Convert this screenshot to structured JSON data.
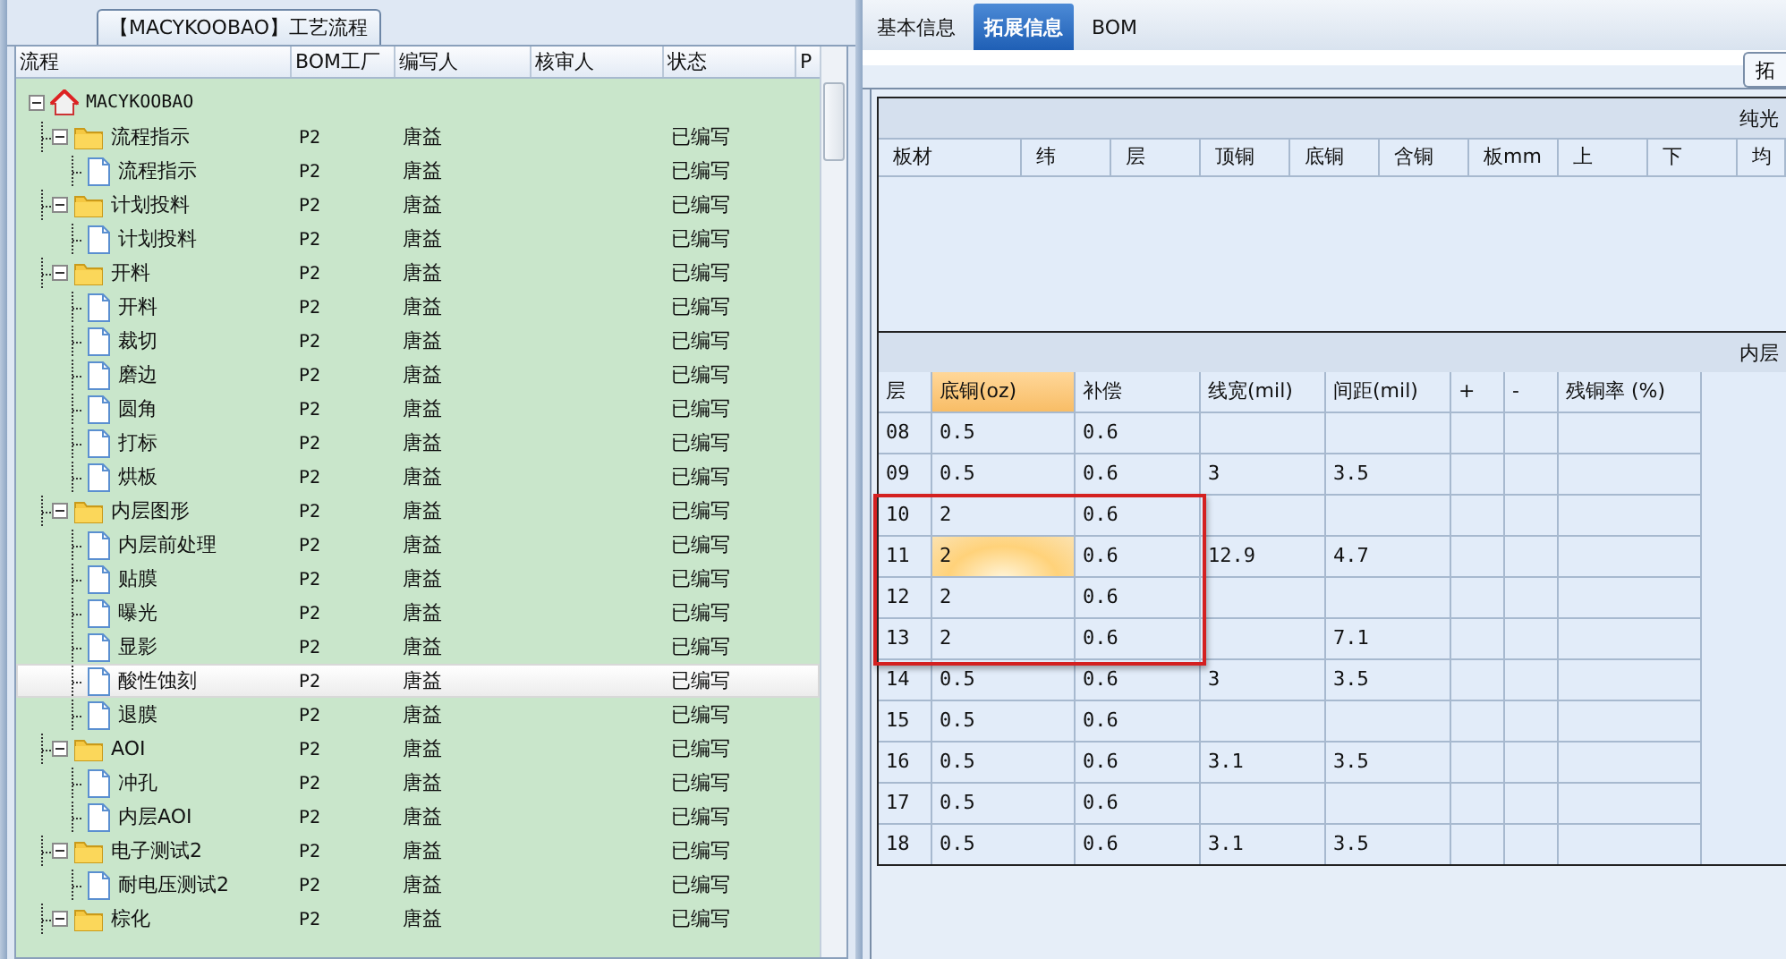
{
  "left_panel": {
    "title": "【MACYKOOBAO】工艺流程",
    "columns": [
      "流程",
      "BOM工厂",
      "编写人",
      "核审人",
      "状态",
      "P"
    ],
    "tree": {
      "label": "MACYKOOBAO",
      "kind": "root",
      "expanded": true,
      "selected": false,
      "children": [
        {
          "label": "流程指示",
          "kind": "folder",
          "expanded": true,
          "selected": false,
          "bom": "P2",
          "author": "唐益",
          "status": "已编写",
          "children": [
            {
              "label": "流程指示",
              "kind": "doc",
              "selected": false,
              "bom": "P2",
              "author": "唐益",
              "status": "已编写"
            }
          ]
        },
        {
          "label": "计划投料",
          "kind": "folder",
          "expanded": true,
          "selected": false,
          "bom": "P2",
          "author": "唐益",
          "status": "已编写",
          "children": [
            {
              "label": "计划投料",
              "kind": "doc",
              "selected": false,
              "bom": "P2",
              "author": "唐益",
              "status": "已编写"
            }
          ]
        },
        {
          "label": "开料",
          "kind": "folder",
          "expanded": true,
          "selected": false,
          "bom": "P2",
          "author": "唐益",
          "status": "已编写",
          "children": [
            {
              "label": "开料",
              "kind": "doc",
              "selected": false,
              "bom": "P2",
              "author": "唐益",
              "status": "已编写"
            },
            {
              "label": "裁切",
              "kind": "doc",
              "selected": false,
              "bom": "P2",
              "author": "唐益",
              "status": "已编写"
            },
            {
              "label": "磨边",
              "kind": "doc",
              "selected": false,
              "bom": "P2",
              "author": "唐益",
              "status": "已编写"
            },
            {
              "label": "圆角",
              "kind": "doc",
              "selected": false,
              "bom": "P2",
              "author": "唐益",
              "status": "已编写"
            },
            {
              "label": "打标",
              "kind": "doc",
              "selected": false,
              "bom": "P2",
              "author": "唐益",
              "status": "已编写"
            },
            {
              "label": "烘板",
              "kind": "doc",
              "selected": false,
              "bom": "P2",
              "author": "唐益",
              "status": "已编写"
            }
          ]
        },
        {
          "label": "内层图形",
          "kind": "folder",
          "expanded": true,
          "selected": false,
          "bom": "P2",
          "author": "唐益",
          "status": "已编写",
          "children": [
            {
              "label": "内层前处理",
              "kind": "doc",
              "selected": false,
              "bom": "P2",
              "author": "唐益",
              "status": "已编写"
            },
            {
              "label": "贴膜",
              "kind": "doc",
              "selected": false,
              "bom": "P2",
              "author": "唐益",
              "status": "已编写"
            },
            {
              "label": "曝光",
              "kind": "doc",
              "selected": false,
              "bom": "P2",
              "author": "唐益",
              "status": "已编写"
            },
            {
              "label": "显影",
              "kind": "doc",
              "selected": false,
              "bom": "P2",
              "author": "唐益",
              "status": "已编写"
            },
            {
              "label": "酸性蚀刻",
              "kind": "doc",
              "selected": true,
              "bom": "P2",
              "author": "唐益",
              "status": "已编写"
            },
            {
              "label": "退膜",
              "kind": "doc",
              "selected": false,
              "bom": "P2",
              "author": "唐益",
              "status": "已编写"
            }
          ]
        },
        {
          "label": "AOI",
          "kind": "folder",
          "expanded": true,
          "selected": false,
          "bom": "P2",
          "author": "唐益",
          "status": "已编写",
          "children": [
            {
              "label": "冲孔",
              "kind": "doc",
              "selected": false,
              "bom": "P2",
              "author": "唐益",
              "status": "已编写"
            },
            {
              "label": "内层AOI",
              "kind": "doc",
              "selected": false,
              "bom": "P2",
              "author": "唐益",
              "status": "已编写"
            }
          ]
        },
        {
          "label": "电子测试2",
          "kind": "folder",
          "expanded": true,
          "selected": false,
          "bom": "P2",
          "author": "唐益",
          "status": "已编写",
          "children": [
            {
              "label": "耐电压测试2",
              "kind": "doc",
              "selected": false,
              "bom": "P2",
              "author": "唐益",
              "status": "已编写"
            }
          ]
        },
        {
          "label": "棕化",
          "kind": "folder",
          "expanded": true,
          "selected": false,
          "bom": "P2",
          "author": "唐益",
          "status": "已编写"
        }
      ]
    }
  },
  "right_panel": {
    "tabs": [
      {
        "label": "基本信息",
        "selected": false
      },
      {
        "label": "拓展信息",
        "selected": true
      },
      {
        "label": "BOM",
        "selected": false
      }
    ],
    "corner_button": "拓",
    "board_table": {
      "band": "纯光",
      "columns": [
        "板材",
        "纬",
        "层",
        "顶铜",
        "底铜",
        "含铜",
        "板mm",
        "上",
        "下",
        "均"
      ]
    },
    "inner_table": {
      "band": "内层",
      "columns": [
        {
          "label": "层",
          "selected": false
        },
        {
          "label": "底铜(oz)",
          "selected": true
        },
        {
          "label": "补偿",
          "selected": false
        },
        {
          "label": "线宽(mil)",
          "selected": false
        },
        {
          "label": "间距(mil)",
          "selected": false
        },
        {
          "label": "+",
          "selected": false
        },
        {
          "label": "-",
          "selected": false
        },
        {
          "label": "残铜率 (%)",
          "selected": false
        }
      ],
      "rows": [
        {
          "cells": [
            {
              "text": "08",
              "selected": false
            },
            {
              "text": "0.5",
              "selected": false
            },
            {
              "text": "0.6",
              "selected": false
            },
            {
              "selected": false
            },
            {
              "selected": false
            },
            {
              "selected": false
            },
            {
              "selected": false
            },
            {
              "selected": false
            }
          ]
        },
        {
          "cells": [
            {
              "text": "09",
              "selected": false
            },
            {
              "text": "0.5",
              "selected": false
            },
            {
              "text": "0.6",
              "selected": false
            },
            {
              "text": "3",
              "selected": false
            },
            {
              "text": "3.5",
              "selected": false
            },
            {
              "selected": false
            },
            {
              "selected": false
            },
            {
              "selected": false
            }
          ]
        },
        {
          "cells": [
            {
              "text": "10",
              "selected": false
            },
            {
              "text": "2",
              "selected": false
            },
            {
              "text": "0.6",
              "selected": false
            },
            {
              "selected": false
            },
            {
              "selected": false
            },
            {
              "selected": false
            },
            {
              "selected": false
            },
            {
              "selected": false
            }
          ]
        },
        {
          "cells": [
            {
              "text": "11",
              "selected": false
            },
            {
              "text": "2",
              "selected": true
            },
            {
              "text": "0.6",
              "selected": false
            },
            {
              "text": "12.9",
              "selected": false
            },
            {
              "text": "4.7",
              "selected": false
            },
            {
              "selected": false
            },
            {
              "selected": false
            },
            {
              "selected": false
            }
          ]
        },
        {
          "cells": [
            {
              "text": "12",
              "selected": false
            },
            {
              "text": "2",
              "selected": false
            },
            {
              "text": "0.6",
              "selected": false
            },
            {
              "selected": false
            },
            {
              "selected": false
            },
            {
              "selected": false
            },
            {
              "selected": false
            },
            {
              "selected": false
            }
          ]
        },
        {
          "cells": [
            {
              "text": "13",
              "selected": false
            },
            {
              "text": "2",
              "selected": false
            },
            {
              "text": "0.6",
              "selected": false
            },
            {
              "selected": false
            },
            {
              "text": "7.1",
              "selected": false
            },
            {
              "selected": false
            },
            {
              "selected": false
            },
            {
              "selected": false
            }
          ]
        },
        {
          "cells": [
            {
              "text": "14",
              "selected": false
            },
            {
              "text": "0.5",
              "selected": false
            },
            {
              "text": "0.6",
              "selected": false
            },
            {
              "text": "3",
              "selected": false
            },
            {
              "text": "3.5",
              "selected": false
            },
            {
              "selected": false
            },
            {
              "selected": false
            },
            {
              "selected": false
            }
          ]
        },
        {
          "cells": [
            {
              "text": "15",
              "selected": false
            },
            {
              "text": "0.5",
              "selected": false
            },
            {
              "text": "0.6",
              "selected": false
            },
            {
              "selected": false
            },
            {
              "selected": false
            },
            {
              "selected": false
            },
            {
              "selected": false
            },
            {
              "selected": false
            }
          ]
        },
        {
          "cells": [
            {
              "text": "16",
              "selected": false
            },
            {
              "text": "0.5",
              "selected": false
            },
            {
              "text": "0.6",
              "selected": false
            },
            {
              "text": "3.1",
              "selected": false
            },
            {
              "text": "3.5",
              "selected": false
            },
            {
              "selected": false
            },
            {
              "selected": false
            },
            {
              "selected": false
            }
          ]
        },
        {
          "cells": [
            {
              "text": "17",
              "selected": false
            },
            {
              "text": "0.5",
              "selected": false
            },
            {
              "text": "0.6",
              "selected": false
            },
            {
              "selected": false
            },
            {
              "selected": false
            },
            {
              "selected": false
            },
            {
              "selected": false
            },
            {
              "selected": false
            }
          ]
        },
        {
          "cells": [
            {
              "text": "18",
              "selected": false
            },
            {
              "text": "0.5",
              "selected": false
            },
            {
              "text": "0.6",
              "selected": false
            },
            {
              "text": "3.1",
              "selected": false
            },
            {
              "text": "3.5",
              "selected": false
            },
            {
              "selected": false
            },
            {
              "selected": false
            },
            {
              "selected": false
            }
          ]
        }
      ]
    }
  }
}
